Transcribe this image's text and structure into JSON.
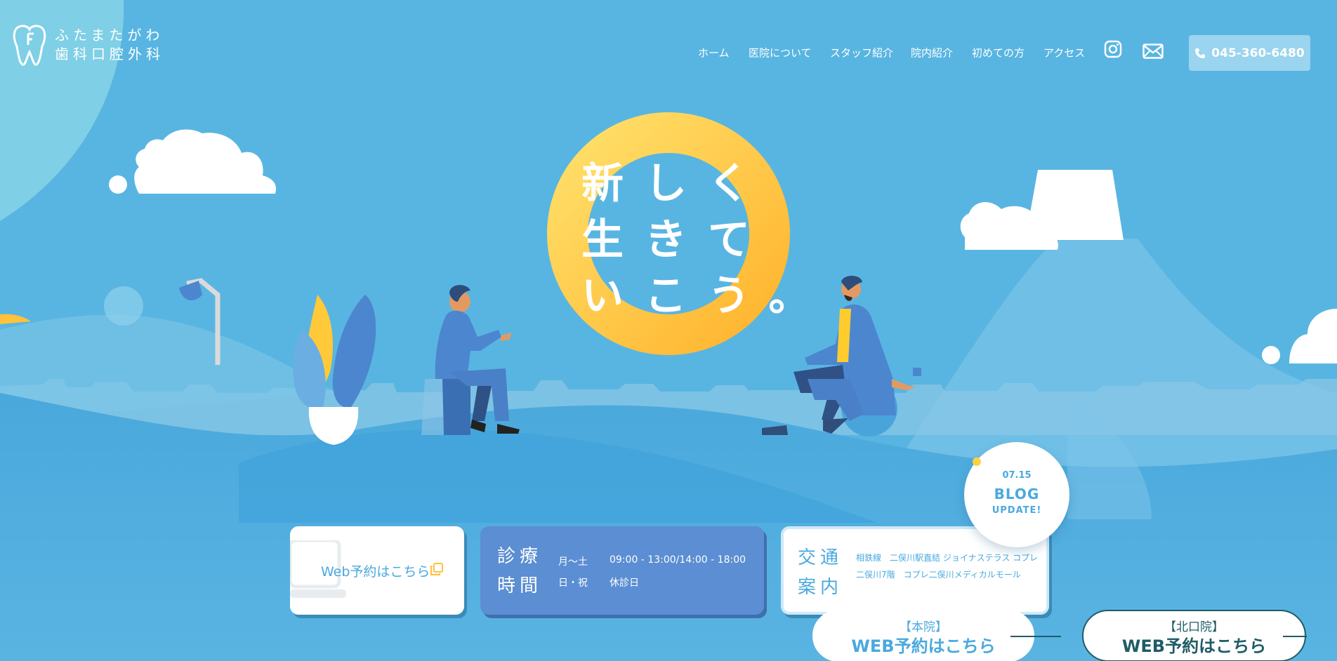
{
  "header": {
    "logo_line1": "ふたまたがわ",
    "logo_line2": "歯科口腔外科",
    "nav": [
      {
        "label": "ホーム"
      },
      {
        "label": "医院について"
      },
      {
        "label": "スタッフ紹介"
      },
      {
        "label": "院内紹介"
      },
      {
        "label": "初めての方"
      },
      {
        "label": "アクセス"
      }
    ],
    "instagram_icon": "instagram-icon",
    "mail_icon": "mail-icon",
    "phone": "045-360-6480"
  },
  "hero": {
    "catch": [
      "新しく",
      "生きて",
      "いこう。"
    ]
  },
  "cards": {
    "web_reserve": "Web予約はこちら",
    "hours_title": [
      "診療",
      "時間"
    ],
    "hours": [
      {
        "days": "月〜土",
        "time": "09:00 - 13:00/14:00 - 18:00"
      },
      {
        "days": "日・祝",
        "time": "休診日"
      }
    ],
    "access_title": [
      "交通",
      "案内"
    ],
    "access_text": "相鉄線　二俣川駅直結 ジョイナステラス コプレ二俣川7階　コプレ二俣川メディカルモール"
  },
  "blog": {
    "date": "07.15",
    "title": "BLOG",
    "sub": "UPDATE!"
  },
  "reserve": {
    "main_sub": "【本院】",
    "main_label": "WEB予約はこちら",
    "north_sub": "【北口院】",
    "north_label": "WEB予約はこちら"
  },
  "colors": {
    "sky": "#55b3e0",
    "accent_yellow": "#ffc23a",
    "card_blue": "#5b8ed2",
    "text_blue": "#4aa9de",
    "dark_teal": "#1e5c66"
  }
}
